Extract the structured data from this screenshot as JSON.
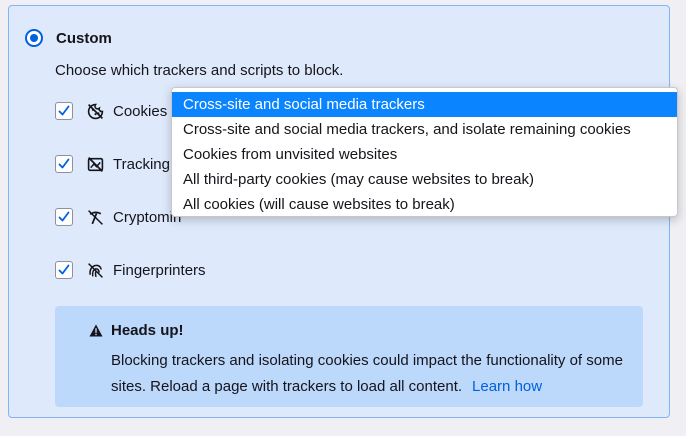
{
  "section": {
    "title": "Custom",
    "description": "Choose which trackers and scripts to block."
  },
  "options": [
    {
      "label": "Cookies",
      "icon": "cookie-icon",
      "checked": true
    },
    {
      "label": "Tracking c",
      "icon": "tracking-content-icon",
      "checked": true
    },
    {
      "label": "Cryptomin",
      "icon": "cryptominer-icon",
      "checked": true
    },
    {
      "label": "Fingerprinters",
      "icon": "fingerprinter-icon",
      "checked": true
    }
  ],
  "dropdown": {
    "selected_index": 0,
    "items": [
      "Cross-site and social media trackers",
      "Cross-site and social media trackers, and isolate remaining cookies",
      "Cookies from unvisited websites",
      "All third-party cookies (may cause websites to break)",
      "All cookies (will cause websites to break)"
    ]
  },
  "warning": {
    "title": "Heads up!",
    "body": "Blocking trackers and isolating cookies could impact the functionality of some sites. Reload a page with trackers to load all content.",
    "link": "Learn how"
  },
  "colors": {
    "panel_bg": "#deeafc",
    "panel_border": "#83b4f5",
    "accent": "#0061e0",
    "highlight": "#0a84ff",
    "warning_bg": "#bcd8fb",
    "link": "#0060df"
  }
}
